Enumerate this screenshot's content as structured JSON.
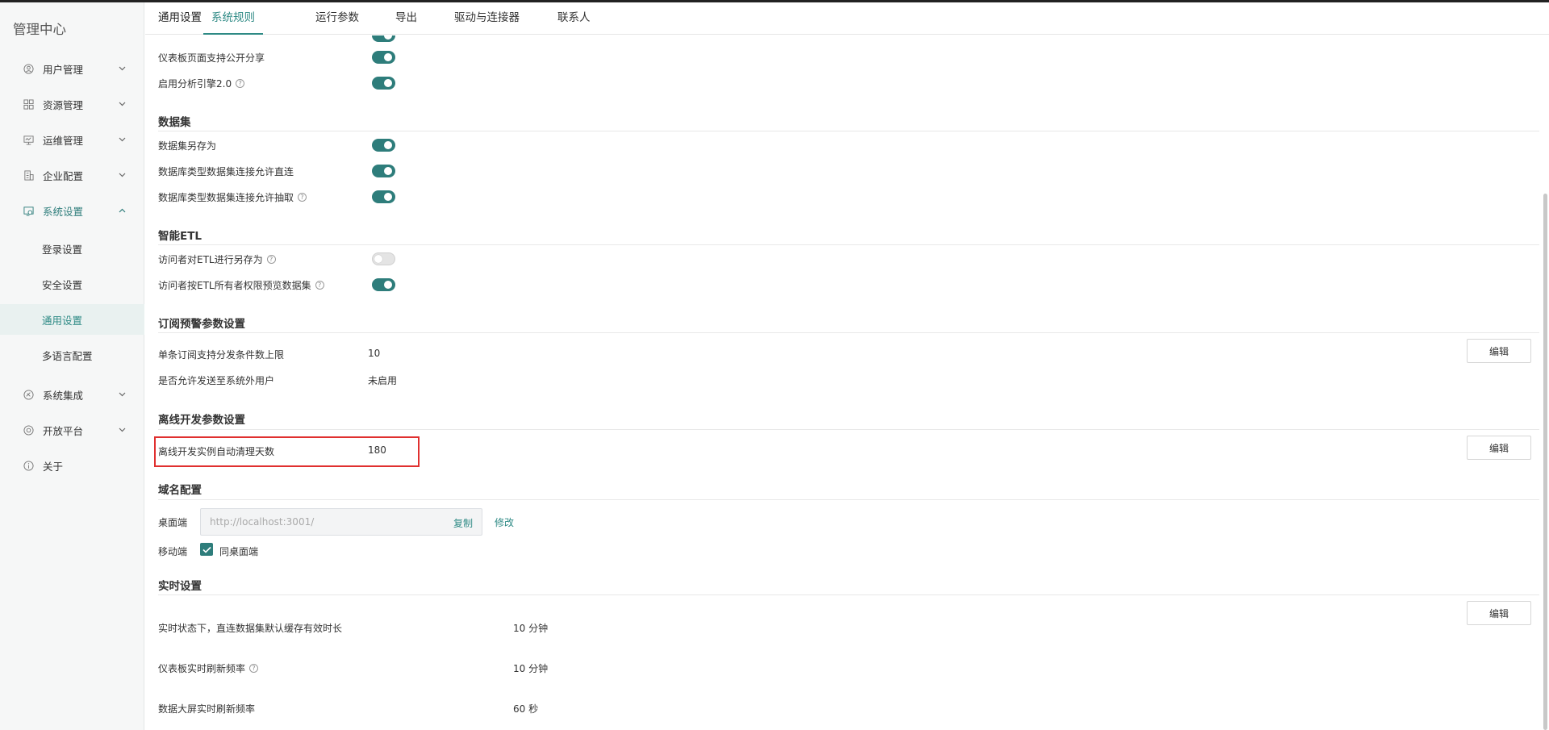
{
  "app": {
    "title": "管理中心"
  },
  "sidebar": {
    "items": [
      {
        "label": "用户管理",
        "icon": "user-icon"
      },
      {
        "label": "资源管理",
        "icon": "grid-icon"
      },
      {
        "label": "运维管理",
        "icon": "monitor-icon"
      },
      {
        "label": "企业配置",
        "icon": "building-icon"
      },
      {
        "label": "系统设置",
        "icon": "settings-icon"
      },
      {
        "label": "系统集成",
        "icon": "integration-icon"
      },
      {
        "label": "开放平台",
        "icon": "open-platform-icon"
      },
      {
        "label": "关于",
        "icon": "info-icon"
      }
    ],
    "sub_items": [
      {
        "label": "登录设置"
      },
      {
        "label": "安全设置"
      },
      {
        "label": "通用设置"
      },
      {
        "label": "多语言配置"
      }
    ]
  },
  "tabs": [
    {
      "label": "通用设置"
    },
    {
      "label": "系统规则"
    },
    {
      "label": "运行参数"
    },
    {
      "label": "导出"
    },
    {
      "label": "驱动与连接器"
    },
    {
      "label": "联系人"
    }
  ],
  "dashboard": {
    "rows": [
      {
        "label": "仪表板页面支持公开分享",
        "enabled": true
      },
      {
        "label": "启用分析引擎2.0",
        "enabled": true
      }
    ]
  },
  "dataset": {
    "title": "数据集",
    "rows": [
      {
        "label": "数据集另存为",
        "enabled": true
      },
      {
        "label": "数据库类型数据集连接允许直连",
        "enabled": true
      },
      {
        "label": "数据库类型数据集连接允许抽取",
        "enabled": true
      }
    ]
  },
  "etl": {
    "title": "智能ETL",
    "rows": [
      {
        "label": "访问者对ETL进行另存为",
        "enabled": false
      },
      {
        "label": "访问者按ETL所有者权限预览数据集",
        "enabled": true
      }
    ]
  },
  "subscription": {
    "title": "订阅预警参数设置",
    "rows": [
      {
        "label": "单条订阅支持分发条件数上限",
        "value": "10"
      },
      {
        "label": "是否允许发送至系统外用户",
        "value": "未启用"
      }
    ],
    "edit_label": "编辑"
  },
  "offline": {
    "title": "离线开发参数设置",
    "rows": [
      {
        "label": "离线开发实例自动清理天数",
        "value": "180"
      }
    ],
    "edit_label": "编辑"
  },
  "domain": {
    "title": "域名配置",
    "desktop_label": "桌面端",
    "desktop_placeholder": "http://localhost:3001/",
    "copy_label": "复制",
    "modify_label": "修改",
    "mobile_label": "移动端",
    "mobile_checkbox_label": "同桌面端",
    "mobile_checked": true
  },
  "realtime": {
    "title": "实时设置",
    "rows": [
      {
        "label": "实时状态下，直连数据集默认缓存有效时长",
        "value": "10 分钟"
      },
      {
        "label": "仪表板实时刷新频率",
        "value": "10 分钟"
      },
      {
        "label": "数据大屏实时刷新频率",
        "value": "60 秒"
      }
    ],
    "edit_label": "编辑"
  }
}
